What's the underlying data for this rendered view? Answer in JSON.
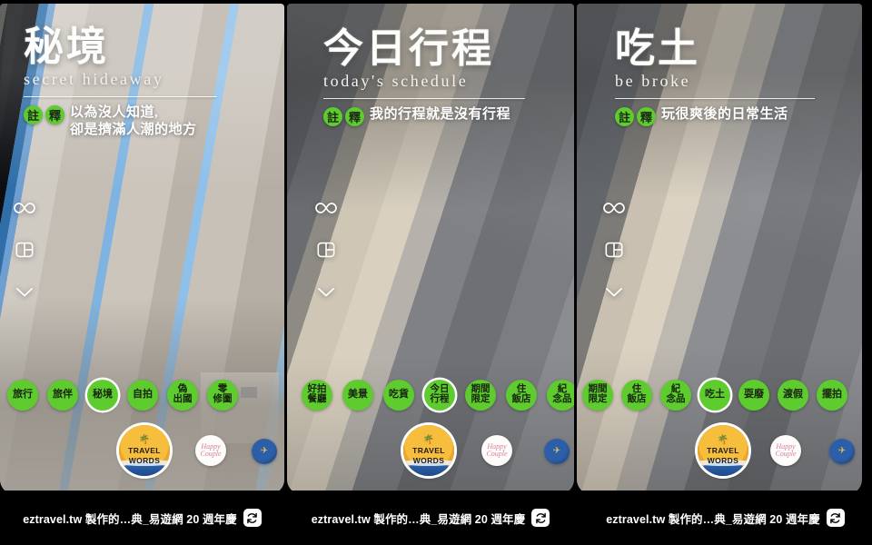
{
  "app": {
    "type": "instagram-story-viewer-triptych",
    "panel_count": 3,
    "accent_green": "#5ecb2e",
    "sticker_orange": "#f2b134",
    "sticker_blue": "#1d4a8c",
    "caption_bar_bg": "#000000"
  },
  "caption": {
    "text": "eztravel.tw 製作的…典_易遊網 20 週年慶",
    "remix_icon": "remix-reels-icon"
  },
  "rail": {
    "icons": [
      {
        "name": "infinity-icon",
        "glyph": "∞"
      },
      {
        "name": "layout-split-icon",
        "glyph": "▣"
      },
      {
        "name": "chevron-down-icon",
        "glyph": "⌄"
      }
    ]
  },
  "stickers": [
    {
      "name": "travel-words-sticker",
      "line1": "TRAVEL",
      "line2": "WORDS",
      "palm": "🌴"
    },
    {
      "name": "happy-script-sticker",
      "text": "Happy\nCouple"
    },
    {
      "name": "blue-globe-sticker",
      "text": "✈"
    }
  ],
  "panels": [
    {
      "id": "panel-secret-hideaway",
      "title_cn": "秘境",
      "title_en": "secret hideaway",
      "note_badges": [
        "註",
        "釋"
      ],
      "note_text_lines": [
        "以為沒人知道,",
        "卻是擠滿人潮的地方"
      ],
      "chips": [
        {
          "label": "旅行",
          "lines": [
            "旅行"
          ],
          "selected": false
        },
        {
          "label": "旅伴",
          "lines": [
            "旅伴"
          ],
          "selected": false
        },
        {
          "label": "秘境",
          "lines": [
            "秘境"
          ],
          "selected": true
        },
        {
          "label": "自拍",
          "lines": [
            "自拍"
          ],
          "selected": false
        },
        {
          "label": "偽出國",
          "lines": [
            "偽",
            "出國"
          ],
          "selected": false
        },
        {
          "label": "零修圖",
          "lines": [
            "零",
            "修圖"
          ],
          "selected": false
        }
      ]
    },
    {
      "id": "panel-todays-schedule",
      "title_cn": "今日行程",
      "title_en": "today's schedule",
      "note_badges": [
        "註",
        "釋"
      ],
      "note_text_lines": [
        "我的行程就是沒有行程"
      ],
      "chips": [
        {
          "label": "好拍餐廳",
          "lines": [
            "好拍",
            "餐廳"
          ],
          "selected": false
        },
        {
          "label": "美景",
          "lines": [
            "美景"
          ],
          "selected": false
        },
        {
          "label": "吃貨",
          "lines": [
            "吃貨"
          ],
          "selected": false
        },
        {
          "label": "今日行程",
          "lines": [
            "今日",
            "行程"
          ],
          "selected": true
        },
        {
          "label": "期間限定",
          "lines": [
            "期間",
            "限定"
          ],
          "selected": false
        },
        {
          "label": "住飯店",
          "lines": [
            "住",
            "飯店"
          ],
          "selected": false
        },
        {
          "label": "紀念品",
          "lines": [
            "紀",
            "念品"
          ],
          "selected": false
        }
      ]
    },
    {
      "id": "panel-be-broke",
      "title_cn": "吃土",
      "title_en": "be broke",
      "note_badges": [
        "註",
        "釋"
      ],
      "note_text_lines": [
        "玩很爽後的日常生活"
      ],
      "chips": [
        {
          "label": "期間限定",
          "lines": [
            "期間",
            "限定"
          ],
          "selected": false
        },
        {
          "label": "住飯店",
          "lines": [
            "住",
            "飯店"
          ],
          "selected": false
        },
        {
          "label": "紀念品",
          "lines": [
            "紀",
            "念品"
          ],
          "selected": false
        },
        {
          "label": "吃土",
          "lines": [
            "吃土"
          ],
          "selected": true
        },
        {
          "label": "耍廢",
          "lines": [
            "耍廢"
          ],
          "selected": false
        },
        {
          "label": "渡假",
          "lines": [
            "渡假"
          ],
          "selected": false
        },
        {
          "label": "擺拍",
          "lines": [
            "擺拍"
          ],
          "selected": false
        }
      ]
    }
  ]
}
